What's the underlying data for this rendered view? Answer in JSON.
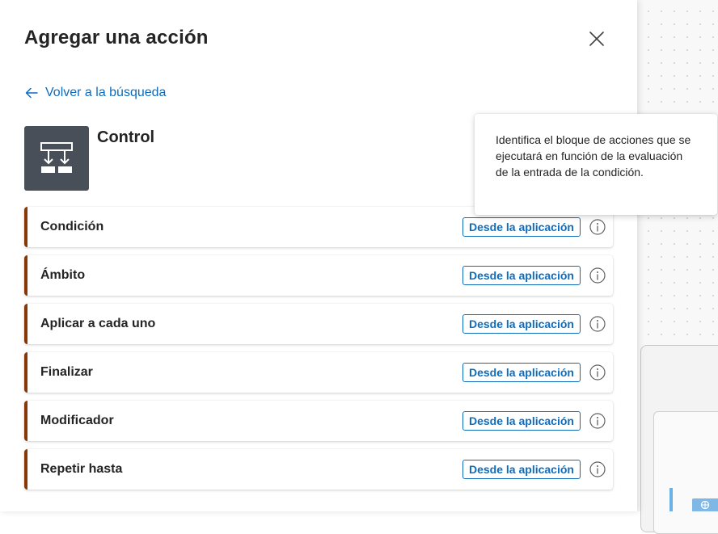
{
  "panel": {
    "title": "Agregar una acción",
    "close_icon": "close-icon",
    "back_label": "Volver a la búsqueda",
    "back_icon": "arrow-left-icon"
  },
  "connector": {
    "name": "Control",
    "icon": "control-branch-icon",
    "tile_color": "#484f58"
  },
  "actions": [
    {
      "label": "Condición",
      "badge": "Desde la aplicación",
      "info_icon": "info-icon"
    },
    {
      "label": "Ámbito",
      "badge": "Desde la aplicación",
      "info_icon": "info-icon"
    },
    {
      "label": "Aplicar a cada uno",
      "badge": "Desde la aplicación",
      "info_icon": "info-icon"
    },
    {
      "label": "Finalizar",
      "badge": "Desde la aplicación",
      "info_icon": "info-icon"
    },
    {
      "label": "Modificador",
      "badge": "Desde la aplicación",
      "info_icon": "info-icon"
    },
    {
      "label": "Repetir hasta",
      "badge": "Desde la aplicación",
      "info_icon": "info-icon"
    }
  ],
  "tooltip": {
    "text": "Identifica el bloque de acciones que se ejecutará en función de la evaluación de la entrada de la condición."
  },
  "colors": {
    "accent": "#0f6cbd",
    "action_stripe": "#8a3707"
  }
}
